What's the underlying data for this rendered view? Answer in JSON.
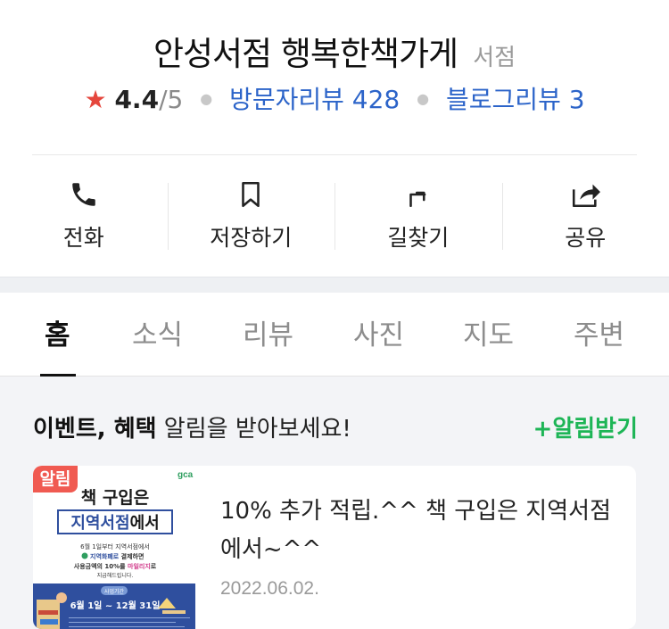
{
  "place": {
    "name": "안성서점 행복한책가게",
    "category": "서점",
    "rating": "4.4",
    "rating_max": "/5",
    "visitor_reviews": "방문자리뷰 428",
    "blog_reviews": "블로그리뷰 3"
  },
  "actions": [
    {
      "label": "전화",
      "icon": "phone-icon"
    },
    {
      "label": "저장하기",
      "icon": "bookmark-icon"
    },
    {
      "label": "길찾기",
      "icon": "directions-icon"
    },
    {
      "label": "공유",
      "icon": "share-icon"
    }
  ],
  "tabs": [
    "홈",
    "소식",
    "리뷰",
    "사진",
    "지도",
    "주변"
  ],
  "active_tab": "홈",
  "event_banner": {
    "bold": "이벤트, 혜택",
    "rest": " 알림을 받아보세요!",
    "notify_label": "+알림받기"
  },
  "news_card": {
    "badge": "알림",
    "title": "10% 추가 적립.^^ 책 구입은 지역서점에서~^^",
    "date": "2022.06.02.",
    "thumb": {
      "logo": "gca",
      "headline1": "책 구입은",
      "headline2_highlight": "지역서점",
      "headline2_rest": "에서",
      "line1": "6월 1일부터 지역서점에서",
      "line2_a": "지역화폐로",
      "line2_b": " 결제하면",
      "line3_a": "사용금액의 10%를 ",
      "line3_highlight": "마일리지",
      "line3_b": "로",
      "line4": "지급해드립니다.",
      "period_label": "사업기간",
      "period": "6월 1일 ~ 12월 31일"
    }
  },
  "colors": {
    "star": "#e5463c",
    "link": "#2c64c9",
    "notify": "#1db556",
    "badge": "#f05a51",
    "thumb_blue": "#2f4f9e"
  }
}
